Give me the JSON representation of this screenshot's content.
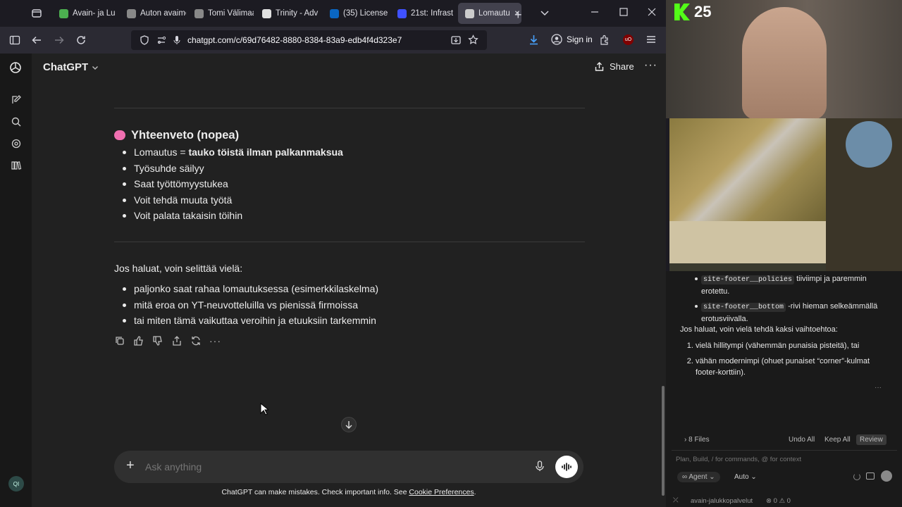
{
  "browser": {
    "tabs": [
      {
        "label": "Avain- ja Lu",
        "color": "#4caf50"
      },
      {
        "label": "Auton avaimet",
        "color": "#888888"
      },
      {
        "label": "Tomi Välimaa",
        "color": "#888888"
      },
      {
        "label": "Trinity - Adv",
        "color": "#e0e0e0"
      },
      {
        "label": "(35) License",
        "color": "#0a66c2"
      },
      {
        "label": "21st: Infrast",
        "color": "#3f51ff"
      },
      {
        "label": "Lomautu",
        "color": "#cccccc"
      }
    ],
    "url": "chatgpt.com/c/69d76482-8880-8384-83a9-edb4f4d323e7",
    "sign_in": "Sign in"
  },
  "chatgpt": {
    "app_name": "ChatGPT",
    "share": "Share",
    "summary": {
      "emoji": "🧠",
      "title": "Yhteenveto (nopea)",
      "first_prefix": "Lomautus = ",
      "first_bold": "tauko töistä ilman palkanmaksua",
      "items": [
        "Työsuhde säilyy",
        "Saat työttömyystukea",
        "Voit tehdä muuta työtä",
        "Voit palata takaisin töihin"
      ]
    },
    "offer_intro": "Jos haluat, voin selittää vielä:",
    "offer_items": [
      "paljonko saat rahaa lomautuksessa (esimerkkilaskelma)",
      "mitä eroa on YT-neuvotteluilla vs pienissä firmoissa",
      "tai miten tämä vaikuttaa veroihin ja etuuksiin tarkemmin"
    ],
    "composer_placeholder": "Ask anything",
    "disclaimer_prefix": "ChatGPT can make mistakes. Check important info. See ",
    "disclaimer_link": "Cookie Preferences",
    "disclaimer_suffix": ".",
    "rail_badge": "QI"
  },
  "stream_overlay": {
    "kick_count": "25",
    "side_panel": {
      "bullets": [
        {
          "code": "site-footer__policies",
          "text": " tiiviimpi ja paremmin erotettu."
        },
        {
          "code": "site-footer__bottom",
          "text": " -rivi hieman selkeämmällä erotusviivalla."
        }
      ],
      "intro": "Jos haluat, voin vielä tehdä kaksi vaihtoehtoa:",
      "options": [
        "vielä hillitympi (vähemmän punaisia pisteitä), tai",
        "vähän modernimpi (ohuet punaiset “corner”-kulmat footer-korttiin)."
      ],
      "files": "8 Files",
      "undo_all": "Undo All",
      "keep_all": "Keep All",
      "review": "Review",
      "input_placeholder": "Plan, Build, / for commands, @ for context",
      "agent": "Agent",
      "auto": "Auto",
      "status_branch": "avain-jalukkopalvelut",
      "status_counts": "⊗ 0 ⚠ 0"
    }
  }
}
